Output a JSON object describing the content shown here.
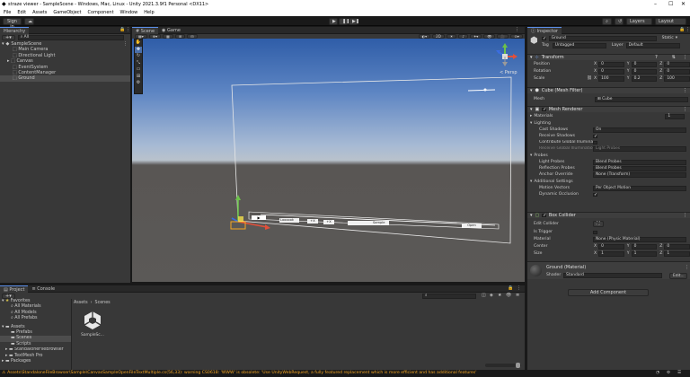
{
  "window": {
    "title": "straze viewer - SampleScene - Windows, Mac, Linux - Unity 2021.3.9f1 Personal <DX11>"
  },
  "menu": [
    "File",
    "Edit",
    "Assets",
    "GameObject",
    "Component",
    "Window",
    "Help"
  ],
  "toolbar": {
    "sign_in": "Sign in",
    "layers": "Layers",
    "layout": "Layout"
  },
  "hierarchy": {
    "tab": "Hierarchy",
    "search_placeholder": "All",
    "scene": "SampleScene",
    "items": [
      "Main Camera",
      "Directional Light",
      "Canvas",
      "EventSystem",
      "ContentManager",
      "Ground"
    ]
  },
  "scene_view": {
    "tabs": [
      "Scene",
      "Game"
    ],
    "mode_2d": "2D",
    "ui": {
      "play_label": "▶",
      "input_text": "Loooook",
      "field1": "+X",
      "field2": "+X",
      "field3": "Sample",
      "button": "Open"
    }
  },
  "inspector": {
    "tab": "Inspector",
    "object_name": "Ground",
    "static_label": "Static",
    "tag_label": "Tag",
    "tag_value": "Untagged",
    "layer_label": "Layer",
    "layer_value": "Default",
    "transform": {
      "title": "Transform",
      "position_label": "Position",
      "position": [
        "0",
        "0",
        "0"
      ],
      "rotation_label": "Rotation",
      "rotation": [
        "0",
        "0",
        "0"
      ],
      "scale_label": "Scale",
      "scale": [
        "100",
        "0.2",
        "100"
      ]
    },
    "mesh_filter": {
      "title": "Cube (Mesh Filter)",
      "mesh_label": "Mesh",
      "mesh_value": "Cube"
    },
    "mesh_renderer": {
      "title": "Mesh Renderer",
      "materials_label": "Materials",
      "materials_count": "1",
      "lighting_label": "Lighting",
      "cast_shadows_label": "Cast Shadows",
      "cast_shadows_value": "On",
      "receive_shadows_label": "Receive Shadows",
      "contribute_gi_label": "Contribute Global Illumination",
      "receive_gi_label": "Receive Global Illumination",
      "receive_gi_value": "Light Probes",
      "probes_label": "Probes",
      "light_probes_label": "Light Probes",
      "light_probes_value": "Blend Probes",
      "reflection_probes_label": "Reflection Probes",
      "reflection_probes_value": "Blend Probes",
      "anchor_override_label": "Anchor Override",
      "anchor_override_value": "None (Transform)",
      "additional_label": "Additional Settings",
      "motion_vectors_label": "Motion Vectors",
      "motion_vectors_value": "Per Object Motion",
      "dynamic_occlusion_label": "Dynamic Occlusion"
    },
    "box_collider": {
      "title": "Box Collider",
      "edit_collider_label": "Edit Collider",
      "is_trigger_label": "Is Trigger",
      "material_label": "Material",
      "material_value": "None (Physic Material)",
      "center_label": "Center",
      "center": [
        "0",
        "0",
        "0"
      ],
      "size_label": "Size",
      "size": [
        "1",
        "1",
        "1"
      ]
    },
    "material": {
      "name": "Ground (Material)",
      "shader_label": "Shader",
      "shader_value": "Standard",
      "edit_label": "Edit..."
    },
    "add_component": "Add Component"
  },
  "project": {
    "tabs": [
      "Project",
      "Console"
    ],
    "favorites_label": "Favorites",
    "favorites": [
      "All Materials",
      "All Models",
      "All Prefabs"
    ],
    "assets_label": "Assets",
    "assets": [
      "Prefabs",
      "Scenes",
      "Scripts",
      "StandaloneFileBrowser",
      "TextMesh Pro"
    ],
    "packages_label": "Packages",
    "breadcrumb": [
      "Assets",
      "Scenes"
    ],
    "file": "SampleSc..."
  },
  "status": {
    "message": "Assets\\StandaloneFileBrowser\\Sample\\CanvasSampleOpenFileTextMultiple.cs(56,33): warning CS0618: 'WWW' is obsolete: 'Use UnityWebRequest, a fully featured replacement which is more efficient and has additional features'"
  },
  "colors": {
    "accent": "#5b8ee8",
    "warning": "#f5a623",
    "bg_dark": "#191919",
    "panel": "#383838"
  }
}
